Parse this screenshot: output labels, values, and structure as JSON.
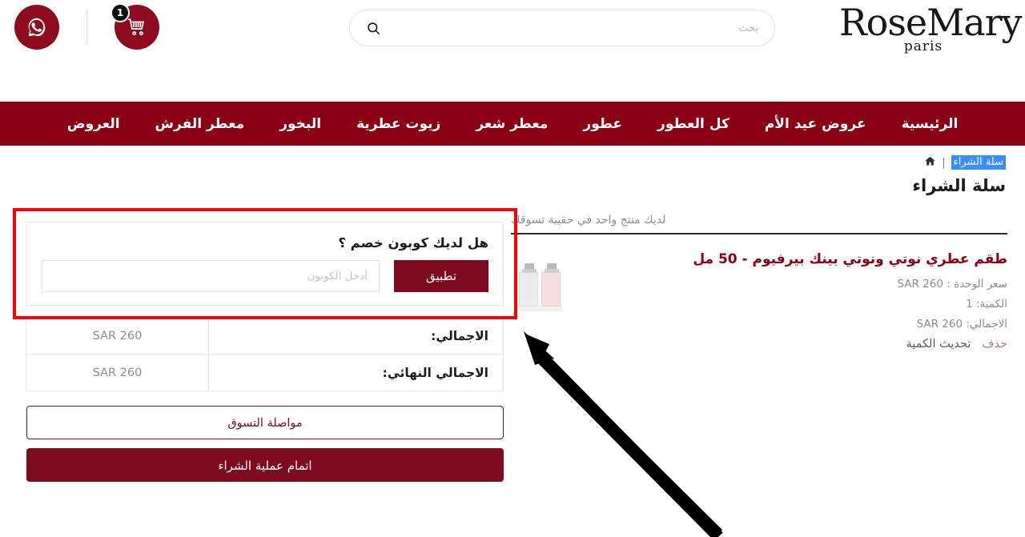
{
  "header": {
    "cart_icon": "shopping-cart-icon",
    "cart_badge_count": "1",
    "whatsapp_icon": "whatsapp-icon",
    "search_icon": "search-icon",
    "search_placeholder": "بحث",
    "search_value": "",
    "logo_main": "RoseMary",
    "logo_sub": "paris"
  },
  "nav": {
    "items": [
      {
        "label": "الرئيسية"
      },
      {
        "label": "عروض عيد الأم"
      },
      {
        "label": "كل العطور"
      },
      {
        "label": "عطور"
      },
      {
        "label": "معطر شعر"
      },
      {
        "label": "زيوت عطرية"
      },
      {
        "label": "البخور"
      },
      {
        "label": "معطر الفرش"
      },
      {
        "label": "العروض"
      }
    ]
  },
  "breadcrumb": {
    "home_icon": "home-icon",
    "separator": "|",
    "current": "سلة الشراء"
  },
  "page_title": "سلة الشراء",
  "cart": {
    "note": "لديك منتج واحد في حقيبة تسوقك",
    "item": {
      "title": "طقم عطري نوتي ونوتي بينك بيرفيوم - 50 مل",
      "unit_price": "سعر الوحدة : SAR 260",
      "quantity": "الكمية: 1",
      "total": "الاجمالي: SAR 260",
      "update_label": "تحديث الكمية",
      "delete_label": "حذف",
      "thumbnail_icon": "perfume-bottles-image"
    }
  },
  "coupon": {
    "title": "هل لديك كوبون خصم ؟",
    "placeholder": "أدخل الكوبون",
    "value": "",
    "apply_label": "تطبيق"
  },
  "totals": {
    "rows": [
      {
        "label": "الاجمالي:",
        "value": "SAR 260"
      },
      {
        "label": "الاجمالي النهائي:",
        "value": "SAR 260"
      }
    ]
  },
  "actions": {
    "continue_label": "مواصلة التسوق",
    "checkout_label": "اتمام عملية الشراء"
  },
  "annotations": {
    "highlight_color": "#ff0000",
    "arrow_color": "#000000",
    "target": "coupon-section"
  },
  "colors": {
    "brand_dark_red": "#8a0015",
    "button_red": "#7d0a1e",
    "badge_black": "#111113",
    "link_rose": "#b5787f",
    "selection_blue": "#3a8dfa"
  }
}
